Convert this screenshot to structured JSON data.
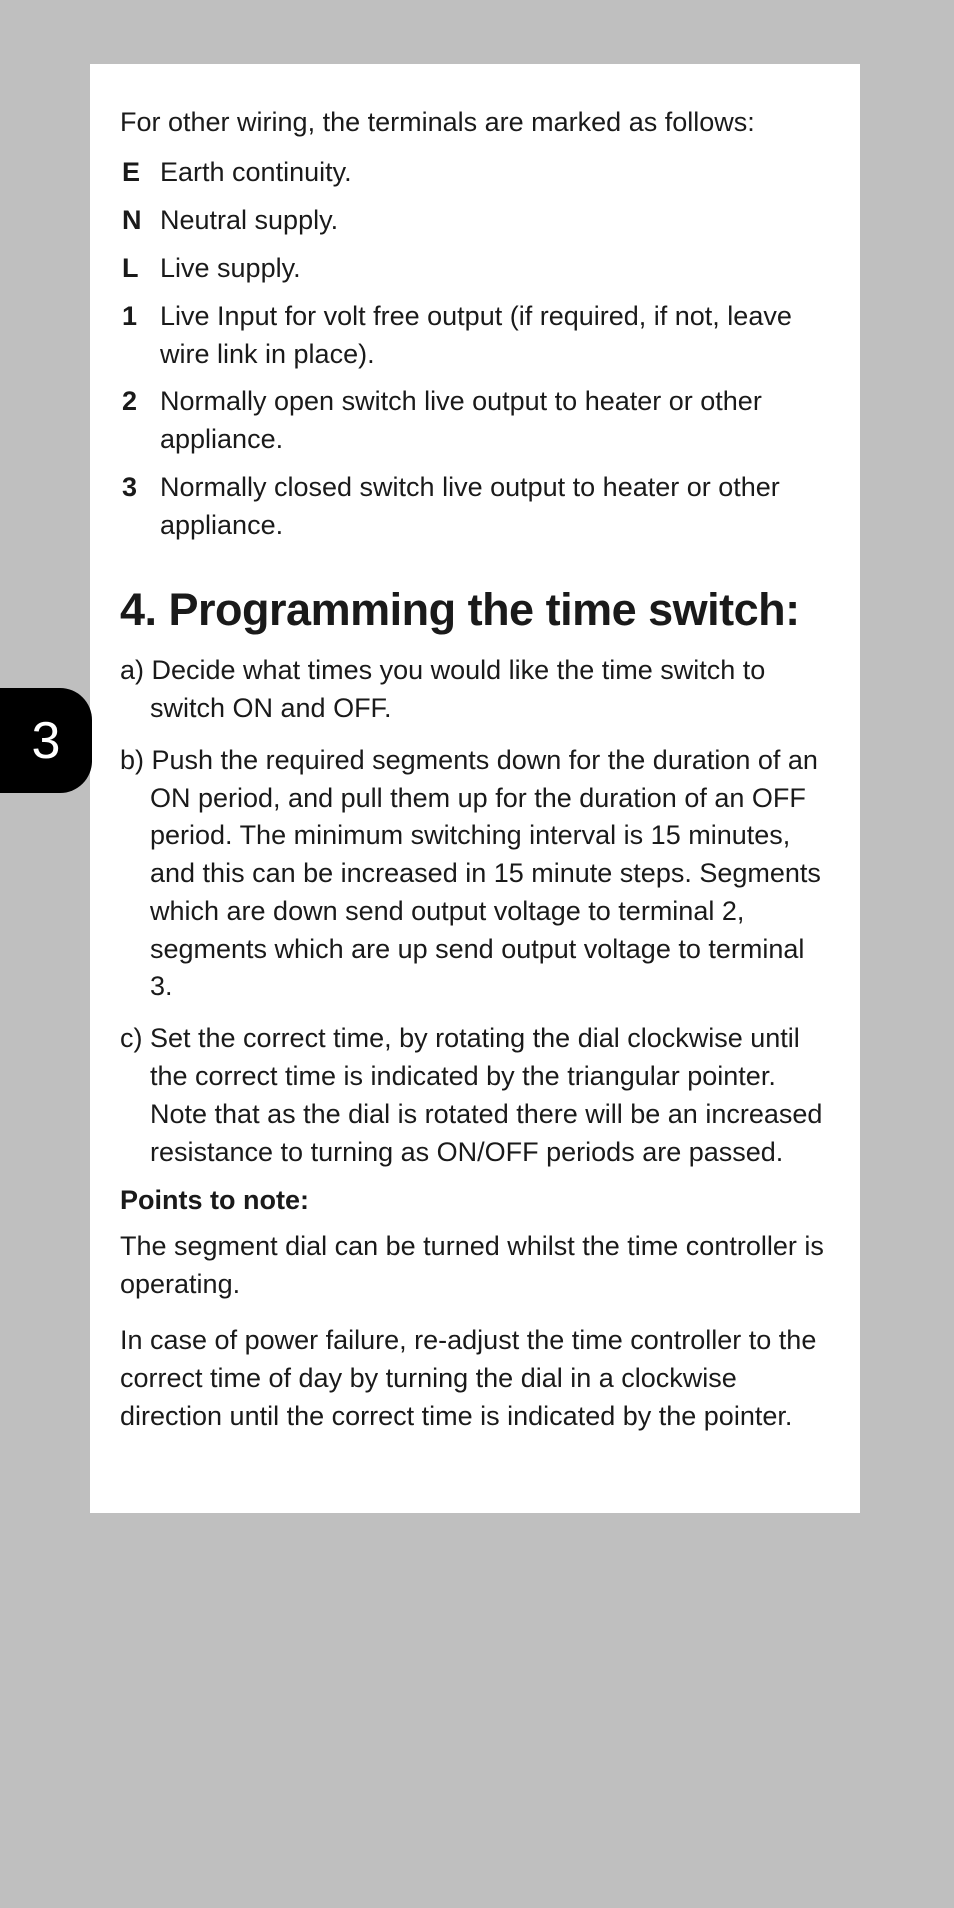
{
  "intro": "For other wiring, the terminals are marked as follows:",
  "terminals": [
    {
      "label": "E",
      "desc": "Earth continuity."
    },
    {
      "label": "N",
      "desc": "Neutral supply."
    },
    {
      "label": "L",
      "desc": "Live supply."
    },
    {
      "label": "1",
      "desc": "Live Input for volt free output (if required, if not, leave wire link in place)."
    },
    {
      "label": "2",
      "desc": "Normally open switch live output to heater or other appliance."
    },
    {
      "label": "3",
      "desc": "Normally closed switch live output to heater or other appliance."
    }
  ],
  "heading": "4. Programming the time switch:",
  "steps": [
    "a) Decide what times you would like the time switch to switch ON and OFF.",
    "b) Push the required segments down for the duration of an ON period, and pull them up for the duration of an OFF period. The minimum switching interval is 15 minutes, and this can be increased in 15 minute steps. Segments which are down send output voltage to terminal 2, segments which are up send output voltage to terminal 3.",
    "c) Set the correct time, by rotating the dial clockwise until the correct time is indicated by the triangular pointer. Note that as the dial is rotated there will be an increased resistance to turning as ON/OFF periods are passed."
  ],
  "sub_heading": "Points to note:",
  "notes": [
    "The segment dial can be turned whilst the time controller is operating.",
    "In case of power failure, re-adjust the time controller to the correct time of day by turning the dial in a clockwise direction until the correct time is indicated by the pointer."
  ],
  "page_number": "3"
}
